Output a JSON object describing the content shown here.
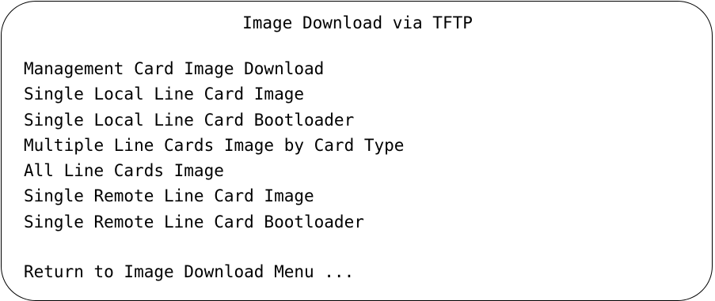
{
  "screen": {
    "title": "Image Download via TFTP"
  },
  "menu": {
    "items": [
      {
        "label": "Management Card Image Download"
      },
      {
        "label": "Single Local Line Card Image"
      },
      {
        "label": "Single Local Line Card Bootloader"
      },
      {
        "label": "Multiple Line Cards Image by Card Type"
      },
      {
        "label": "All Line Cards Image"
      },
      {
        "label": "Single Remote Line Card Image"
      },
      {
        "label": "Single Remote Line Card Bootloader"
      }
    ],
    "return_label": "Return to Image Download Menu ..."
  },
  "colors": {
    "text": "#000000",
    "background": "#ffffff",
    "border": "#000000"
  }
}
